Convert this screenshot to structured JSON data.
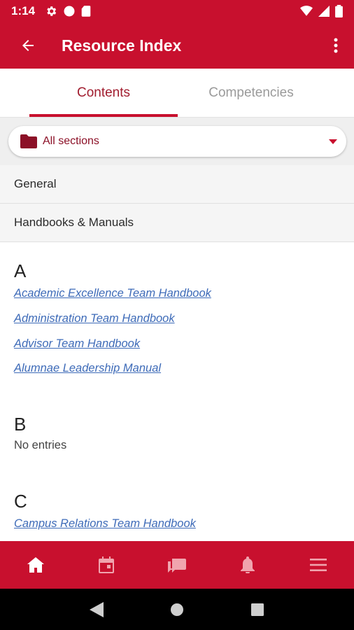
{
  "status_bar": {
    "time": "1:14"
  },
  "app_bar": {
    "title": "Resource Index"
  },
  "tabs": [
    {
      "label": "Contents",
      "active": true
    },
    {
      "label": "Competencies",
      "active": false
    }
  ],
  "filter": {
    "selected": "All sections"
  },
  "sections": [
    "General",
    "Handbooks & Manuals"
  ],
  "index": {
    "A": {
      "letter": "A",
      "items": [
        "Academic Excellence Team Handbook",
        "Administration Team Handbook",
        "Advisor Team Handbook",
        "Alumnae Leadership Manual"
      ]
    },
    "B": {
      "letter": "B",
      "empty_text": "No entries"
    },
    "C": {
      "letter": "C",
      "items": [
        "Campus Relations Team Handbook"
      ]
    }
  },
  "bottom_nav": [
    {
      "icon": "home-icon",
      "active": true
    },
    {
      "icon": "calendar-icon",
      "active": false
    },
    {
      "icon": "chat-icon",
      "active": false
    },
    {
      "icon": "bell-icon",
      "active": false
    },
    {
      "icon": "menu-icon",
      "active": false
    }
  ],
  "colors": {
    "brand": "#c8102e",
    "link": "#3e6bb8",
    "filter_label": "#8c1027"
  }
}
